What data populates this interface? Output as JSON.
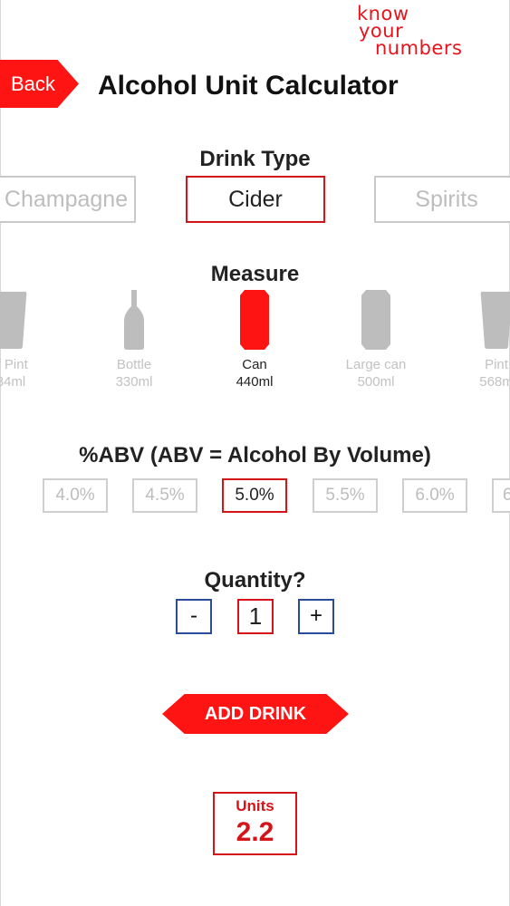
{
  "logo": {
    "line1": "know",
    "line2": "your",
    "line3": "numbers"
  },
  "header": {
    "back_label": "Back",
    "title": "Alcohol Unit Calculator"
  },
  "drink_type": {
    "title": "Drink Type",
    "options": [
      "Champagne",
      "Cider",
      "Spirits"
    ],
    "selected": "Cider"
  },
  "measure": {
    "title": "Measure",
    "options": [
      {
        "name": "lf Pint",
        "volume": "84ml",
        "icon": "pint-glass-icon"
      },
      {
        "name": "Bottle",
        "volume": "330ml",
        "icon": "bottle-icon"
      },
      {
        "name": "Can",
        "volume": "440ml",
        "icon": "can-icon"
      },
      {
        "name": "Large can",
        "volume": "500ml",
        "icon": "large-can-icon"
      },
      {
        "name": "Pint",
        "volume": "568m",
        "icon": "pint-glass-icon"
      }
    ],
    "selected": "Can"
  },
  "abv": {
    "title": "%ABV (ABV = Alcohol By Volume)",
    "options": [
      "4.0%",
      "4.5%",
      "5.0%",
      "5.5%",
      "6.0%",
      "6"
    ],
    "selected": "5.0%"
  },
  "quantity": {
    "title": "Quantity?",
    "minus_label": "-",
    "value": "1",
    "plus_label": "+"
  },
  "add_drink_label": "ADD DRINK",
  "units": {
    "label": "Units",
    "value": "2.2"
  },
  "colors": {
    "accent": "#ff1414",
    "border_red": "#d41419",
    "border_blue": "#2b4b9b",
    "inactive": "#bdbdbd"
  }
}
